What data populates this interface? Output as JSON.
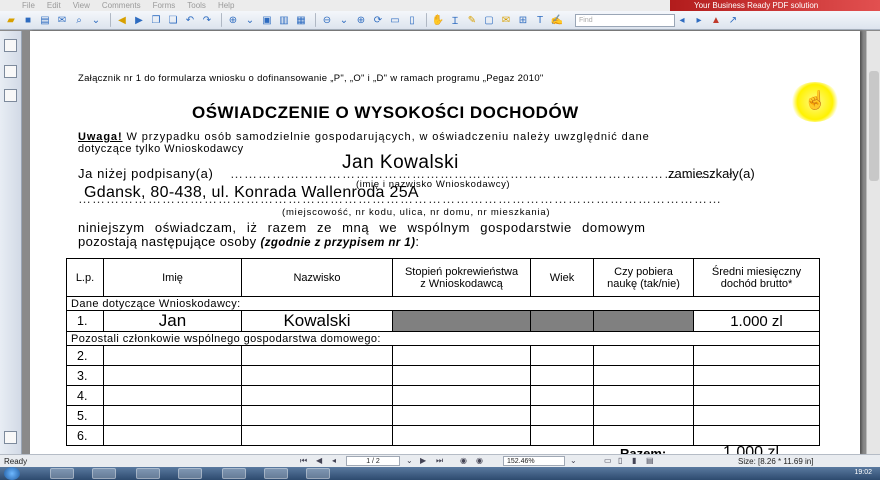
{
  "menu": [
    "File",
    "Edit",
    "View",
    "Comments",
    "Forms",
    "Tools",
    "Help"
  ],
  "brand_banner": "Your Business Ready PDF solution",
  "find_placeholder": "Find",
  "document": {
    "annex": "Załącznik nr 1 do formularza wniosku o dofinansowanie „P\", „O\" i „D\" w ramach programu „Pegaz 2010\"",
    "title": "OŚWIADCZENIE O WYSOKOŚCI DOCHODÓW",
    "warning_label": "Uwaga!",
    "warning_text": " W przypadku osób samodzielnie gospodarujących, w oświadczeniu należy uwzględnić dane",
    "warning_text2": "dotyczące tylko Wnioskodawcy",
    "undersigned": "Ja niżej podpisany(a)",
    "dots_name": "…………………………………………………………………………………………..",
    "residing": "zamieszkały(a)",
    "name_value": "Jan Kowalski",
    "name_caption": "(imię i nazwisko Wnioskodawcy)",
    "address_value": "Gdansk, 80-438, ul. Konrada Wallenroda 25A",
    "dots_address": "…………………………………………………………………………………………………………………………",
    "address_caption": "(miejscowość,   nr kodu,   ulica,   nr domu,   nr mieszkania)",
    "declaration_line1": "niniejszym oświadczam, iż razem ze mną we wspólnym gospodarstwie domowym",
    "declaration_line2": "pozostają następujące osoby ",
    "declaration_note": "(zgodnie z przypisem nr 1)",
    "declaration_colon": ":"
  },
  "table": {
    "headers": [
      "L.p.",
      "Imię",
      "Nazwisko",
      "Stopień pokrewieństwa z Wnioskodawcą",
      "Wiek",
      "Czy pobiera naukę (tak/nie)",
      "Średni miesięczny dochód brutto*"
    ],
    "section_applicant": "Dane dotyczące Wnioskodawcy:",
    "applicant_row": {
      "lp": "1.",
      "first_name": "Jan",
      "last_name": "Kowalski",
      "income": "1.000 zl"
    },
    "section_others": "Pozostali członkowie wspólnego gospodarstwa domowego:",
    "other_rows": [
      "2.",
      "3.",
      "4.",
      "5.",
      "6."
    ],
    "sum_label": "Razem:",
    "sum_value": "1.000 zl"
  },
  "status": {
    "text": "Ready",
    "page_count": "1 / 2",
    "zoom": "152.46%",
    "size": "Size: [8.26 * 11.69 in]",
    "clock": "19:02"
  }
}
